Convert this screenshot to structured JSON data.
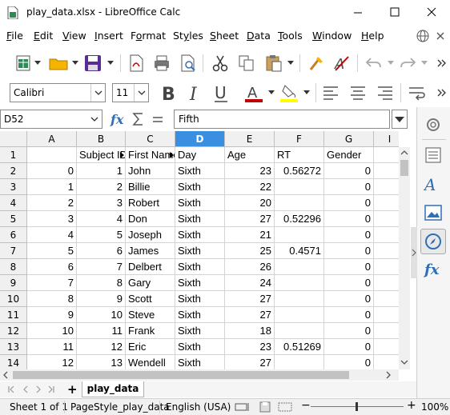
{
  "window": {
    "title": "play_data.xlsx - LibreOffice Calc",
    "minimize_icon": "minimize-icon",
    "maximize_icon": "maximize-icon",
    "close_icon": "close-icon"
  },
  "menubar": {
    "items": [
      {
        "label": "File",
        "accel": "F"
      },
      {
        "label": "Edit",
        "accel": "E"
      },
      {
        "label": "View",
        "accel": "V"
      },
      {
        "label": "Insert",
        "accel": "I"
      },
      {
        "label": "Format",
        "accel": "o"
      },
      {
        "label": "Styles",
        "accel": "y"
      },
      {
        "label": "Sheet",
        "accel": "S"
      },
      {
        "label": "Data",
        "accel": "D"
      },
      {
        "label": "Tools",
        "accel": "T"
      },
      {
        "label": "Window",
        "accel": "W"
      },
      {
        "label": "Help",
        "accel": "H"
      }
    ]
  },
  "format_toolbar": {
    "font_name": "Calibri",
    "font_size": "11"
  },
  "formula_bar": {
    "cell_ref": "D52",
    "content": "Fifth"
  },
  "colors": {
    "accent": "#3b8fe0",
    "font_color": "#c00000",
    "highlight": "#ffff00",
    "green_icon": "#2e8b57"
  },
  "sheet": {
    "columns": [
      "A",
      "B",
      "C",
      "D",
      "E",
      "F",
      "G"
    ],
    "partial_column": "I",
    "selected_column": "D",
    "rows": [
      {
        "n": "1",
        "cells": [
          "",
          "Subject ID",
          "First Name",
          "Day",
          "Age",
          "RT",
          "Gender"
        ]
      },
      {
        "n": "2",
        "cells": [
          "0",
          "1",
          "John",
          "Sixth",
          "23",
          "0.56272",
          "0"
        ]
      },
      {
        "n": "3",
        "cells": [
          "1",
          "2",
          "Billie",
          "Sixth",
          "22",
          "",
          "0"
        ]
      },
      {
        "n": "4",
        "cells": [
          "2",
          "3",
          "Robert",
          "Sixth",
          "20",
          "",
          "0"
        ]
      },
      {
        "n": "5",
        "cells": [
          "3",
          "4",
          "Don",
          "Sixth",
          "27",
          "0.52296",
          "0"
        ]
      },
      {
        "n": "6",
        "cells": [
          "4",
          "5",
          "Joseph",
          "Sixth",
          "21",
          "",
          "0"
        ]
      },
      {
        "n": "7",
        "cells": [
          "5",
          "6",
          "James",
          "Sixth",
          "25",
          "0.4571",
          "0"
        ]
      },
      {
        "n": "8",
        "cells": [
          "6",
          "7",
          "Delbert",
          "Sixth",
          "26",
          "",
          "0"
        ]
      },
      {
        "n": "9",
        "cells": [
          "7",
          "8",
          "Gary",
          "Sixth",
          "24",
          "",
          "0"
        ]
      },
      {
        "n": "10",
        "cells": [
          "8",
          "9",
          "Scott",
          "Sixth",
          "27",
          "",
          "0"
        ]
      },
      {
        "n": "11",
        "cells": [
          "9",
          "10",
          "Steve",
          "Sixth",
          "27",
          "",
          "0"
        ]
      },
      {
        "n": "12",
        "cells": [
          "10",
          "11",
          "Frank",
          "Sixth",
          "18",
          "",
          "0"
        ]
      },
      {
        "n": "13",
        "cells": [
          "11",
          "12",
          "Eric",
          "Sixth",
          "23",
          "0.51269",
          "0"
        ]
      },
      {
        "n": "14",
        "cells": [
          "12",
          "13",
          "Wendell",
          "Sixth",
          "27",
          "",
          "0"
        ]
      }
    ]
  },
  "tabs": {
    "add_label": "+",
    "sheet_name": "play_data"
  },
  "statusbar": {
    "sheet_pos": "Sheet 1 of 1",
    "page_style": "PageStyle_play_data",
    "language": "English (USA)",
    "zoom": "100%",
    "zoom_minus": "−",
    "zoom_plus": "+"
  }
}
